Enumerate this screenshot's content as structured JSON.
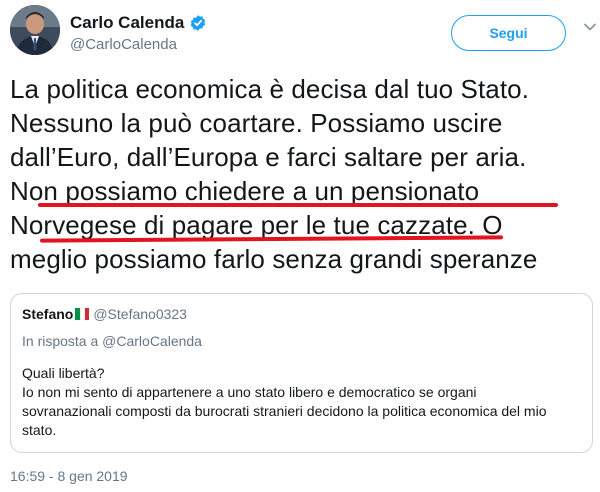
{
  "header": {
    "display_name": "Carlo Calenda",
    "handle": "@CarloCalenda",
    "follow_label": "Segui"
  },
  "tweet": {
    "lines": [
      "La politica economica è decisa dal tuo Stato.",
      "Nessuno la può coartare. Possiamo uscire",
      "dall’Euro, dall’Europa e farci saltare per aria.",
      "Non possiamo chiedere a un pensionato",
      "Norvegese di pagare per le tue cazzate.  O",
      "meglio possiamo farlo senza grandi speranze"
    ],
    "timestamp": "16:59 - 8 gen 2019"
  },
  "quoted_tweet": {
    "name": "Stefano",
    "handle": "@Stefano0323",
    "reply_to": "In risposta a @CarloCalenda",
    "body_lines": [
      "Quali libertà?",
      "Io non mi sento di appartenere a uno stato libero e democratico se organi",
      "sovranazionali composti da burocrati stranieri decidono la politica economica del mio",
      "stato."
    ]
  },
  "colors": {
    "accent": "#1da1f2",
    "underline": "#e1141f",
    "muted": "#657786",
    "flag": [
      "#009246",
      "#ffffff",
      "#ce2b37"
    ]
  },
  "icons": [
    "avatar",
    "verified-badge-icon",
    "chevron-down-icon",
    "italy-flag-icon"
  ]
}
